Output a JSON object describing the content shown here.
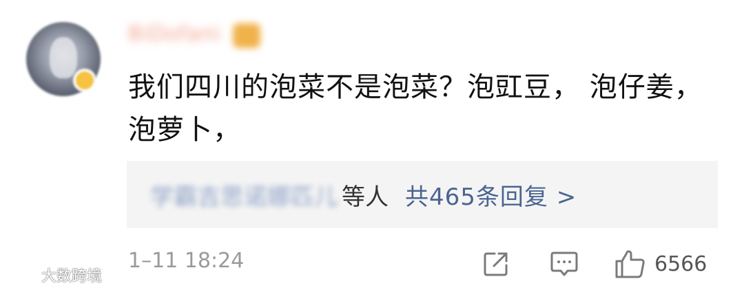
{
  "comment": {
    "username": "BiDofani",
    "text": "我们四川的泡菜不是泡菜？泡豇豆， 泡仔姜，泡萝卜，",
    "timestamp": "1–11 18:24"
  },
  "replies": {
    "names": "学霸吉思诺娜匹儿",
    "names_suffix": "等人",
    "count_label": "共465条回复 >"
  },
  "actions": {
    "share_icon": "share-icon",
    "comment_icon": "comment-icon",
    "like_icon": "thumbs-up-icon",
    "like_count": "6566"
  },
  "watermark": {
    "text": "大数跨境"
  },
  "colors": {
    "link": "#4a6491",
    "reply_bg": "#f4f4f4",
    "muted": "#9a9a9a",
    "username": "#f2a08a"
  }
}
